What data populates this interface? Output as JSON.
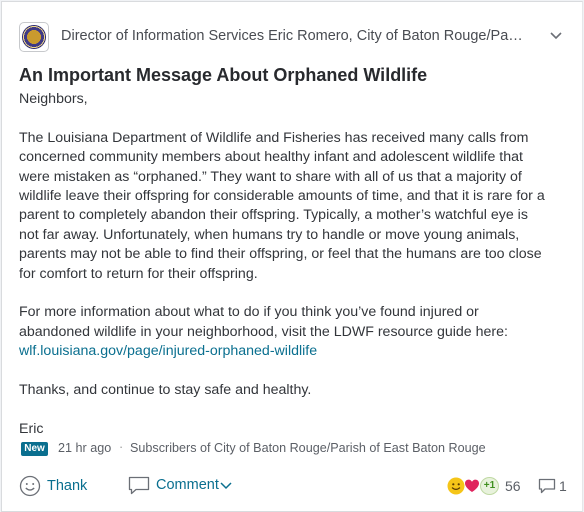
{
  "post": {
    "author": "Director of Information Services Eric Romero, City of Baton Rouge/Pa…",
    "title": "An Important Message About Orphaned Wildlife",
    "greeting": "Neighbors,",
    "paragraph1": "The Louisiana Department of Wildlife and Fisheries has received many calls from concerned community members about healthy infant and adolescent wildlife that were mistaken as “orphaned.” They want to share with all of us that a majority of wildlife leave their offspring for considerable amounts of time, and that it is rare for a parent to completely abandon their offspring. Typically, a mother’s watchful eye is not far away. Unfortunately, when humans try to handle or move young animals, parents may not be able to find their offspring, or feel that the humans are too close for comfort to return for their offspring.",
    "paragraph2": "For more information about what to do if you think you’ve found injured or abandoned wildlife in your neighborhood, visit the LDWF resource guide here:",
    "link_text": "wlf.louisiana.gov/page/injured-orphaned-wildlife",
    "closing": "Thanks, and continue to stay safe and healthy.",
    "signature": "Eric"
  },
  "meta": {
    "badge": "New",
    "time": "21 hr ago",
    "separator": "·",
    "audience": "Subscribers of City of Baton Rouge/Parish of East Baton Rouge"
  },
  "actions": {
    "thank_label": "Thank",
    "comment_label": "Comment",
    "reaction_plus": "+1",
    "reaction_count": "56",
    "reply_count": "1"
  },
  "colors": {
    "accent": "#0a6f8f",
    "badge_bg": "#0a6f8f",
    "heart": "#e0245e",
    "smile": "#f5c518"
  },
  "icons": [
    "city-seal-avatar",
    "chevron-down-icon",
    "smile-icon",
    "comment-bubble-icon",
    "chevron-down-icon",
    "smile-reaction-icon",
    "heart-reaction-icon",
    "plus-one-reaction-icon",
    "reply-bubble-icon"
  ]
}
